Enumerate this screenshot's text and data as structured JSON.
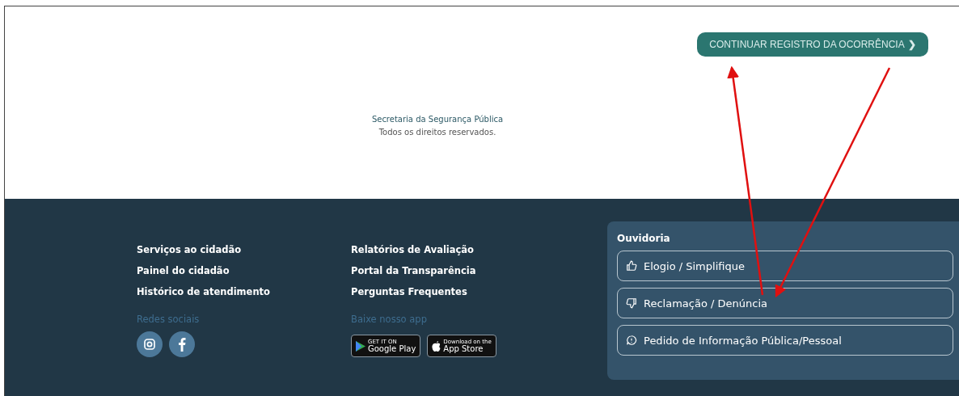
{
  "header": {
    "button": {
      "label": "CONTINUAR REGISTRO DA OCORRÊNCIA",
      "icon": "❯"
    },
    "copyright": {
      "org": "Secretaria da Segurança Pública",
      "rights": "Todos os direitos reservados."
    }
  },
  "footer": {
    "links_left": [
      "Serviços ao cidadão",
      "Painel do cidadão",
      "Histórico de atendimento"
    ],
    "links_right": [
      "Relatórios de Avaliação",
      "Portal da Transparência",
      "Perguntas Frequentes"
    ],
    "social": {
      "title": "Redes sociais",
      "items": [
        {
          "kind": "instagram"
        },
        {
          "kind": "facebook"
        }
      ]
    },
    "app": {
      "title": "Baixe nosso app",
      "stores": [
        {
          "kind": "google",
          "small": "GET IT ON",
          "big": "Google Play"
        },
        {
          "kind": "apple",
          "small": "Download on the",
          "big": "App Store"
        }
      ]
    },
    "ouvidoria": {
      "title": "Ouvidoria",
      "items": [
        {
          "kind": "like",
          "label": "Elogio / Simplifique"
        },
        {
          "kind": "dislike",
          "label": "Reclamação / Denúncia"
        },
        {
          "kind": "info",
          "label": "Pedido de Informação Pública/Pessoal"
        }
      ]
    }
  },
  "annotations": [
    {
      "kind": "arrow"
    },
    {
      "kind": "arrow"
    }
  ]
}
